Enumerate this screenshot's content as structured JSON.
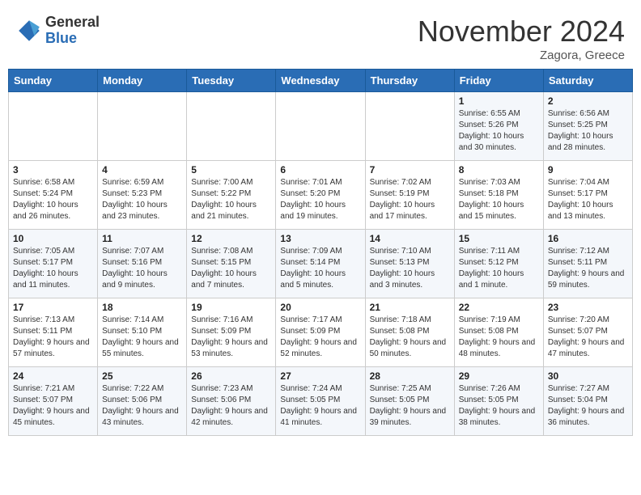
{
  "header": {
    "logo_general": "General",
    "logo_blue": "Blue",
    "month_title": "November 2024",
    "location": "Zagora, Greece"
  },
  "weekdays": [
    "Sunday",
    "Monday",
    "Tuesday",
    "Wednesday",
    "Thursday",
    "Friday",
    "Saturday"
  ],
  "weeks": [
    [
      {
        "day": "",
        "info": ""
      },
      {
        "day": "",
        "info": ""
      },
      {
        "day": "",
        "info": ""
      },
      {
        "day": "",
        "info": ""
      },
      {
        "day": "",
        "info": ""
      },
      {
        "day": "1",
        "info": "Sunrise: 6:55 AM\nSunset: 5:26 PM\nDaylight: 10 hours and 30 minutes."
      },
      {
        "day": "2",
        "info": "Sunrise: 6:56 AM\nSunset: 5:25 PM\nDaylight: 10 hours and 28 minutes."
      }
    ],
    [
      {
        "day": "3",
        "info": "Sunrise: 6:58 AM\nSunset: 5:24 PM\nDaylight: 10 hours and 26 minutes."
      },
      {
        "day": "4",
        "info": "Sunrise: 6:59 AM\nSunset: 5:23 PM\nDaylight: 10 hours and 23 minutes."
      },
      {
        "day": "5",
        "info": "Sunrise: 7:00 AM\nSunset: 5:22 PM\nDaylight: 10 hours and 21 minutes."
      },
      {
        "day": "6",
        "info": "Sunrise: 7:01 AM\nSunset: 5:20 PM\nDaylight: 10 hours and 19 minutes."
      },
      {
        "day": "7",
        "info": "Sunrise: 7:02 AM\nSunset: 5:19 PM\nDaylight: 10 hours and 17 minutes."
      },
      {
        "day": "8",
        "info": "Sunrise: 7:03 AM\nSunset: 5:18 PM\nDaylight: 10 hours and 15 minutes."
      },
      {
        "day": "9",
        "info": "Sunrise: 7:04 AM\nSunset: 5:17 PM\nDaylight: 10 hours and 13 minutes."
      }
    ],
    [
      {
        "day": "10",
        "info": "Sunrise: 7:05 AM\nSunset: 5:17 PM\nDaylight: 10 hours and 11 minutes."
      },
      {
        "day": "11",
        "info": "Sunrise: 7:07 AM\nSunset: 5:16 PM\nDaylight: 10 hours and 9 minutes."
      },
      {
        "day": "12",
        "info": "Sunrise: 7:08 AM\nSunset: 5:15 PM\nDaylight: 10 hours and 7 minutes."
      },
      {
        "day": "13",
        "info": "Sunrise: 7:09 AM\nSunset: 5:14 PM\nDaylight: 10 hours and 5 minutes."
      },
      {
        "day": "14",
        "info": "Sunrise: 7:10 AM\nSunset: 5:13 PM\nDaylight: 10 hours and 3 minutes."
      },
      {
        "day": "15",
        "info": "Sunrise: 7:11 AM\nSunset: 5:12 PM\nDaylight: 10 hours and 1 minute."
      },
      {
        "day": "16",
        "info": "Sunrise: 7:12 AM\nSunset: 5:11 PM\nDaylight: 9 hours and 59 minutes."
      }
    ],
    [
      {
        "day": "17",
        "info": "Sunrise: 7:13 AM\nSunset: 5:11 PM\nDaylight: 9 hours and 57 minutes."
      },
      {
        "day": "18",
        "info": "Sunrise: 7:14 AM\nSunset: 5:10 PM\nDaylight: 9 hours and 55 minutes."
      },
      {
        "day": "19",
        "info": "Sunrise: 7:16 AM\nSunset: 5:09 PM\nDaylight: 9 hours and 53 minutes."
      },
      {
        "day": "20",
        "info": "Sunrise: 7:17 AM\nSunset: 5:09 PM\nDaylight: 9 hours and 52 minutes."
      },
      {
        "day": "21",
        "info": "Sunrise: 7:18 AM\nSunset: 5:08 PM\nDaylight: 9 hours and 50 minutes."
      },
      {
        "day": "22",
        "info": "Sunrise: 7:19 AM\nSunset: 5:08 PM\nDaylight: 9 hours and 48 minutes."
      },
      {
        "day": "23",
        "info": "Sunrise: 7:20 AM\nSunset: 5:07 PM\nDaylight: 9 hours and 47 minutes."
      }
    ],
    [
      {
        "day": "24",
        "info": "Sunrise: 7:21 AM\nSunset: 5:07 PM\nDaylight: 9 hours and 45 minutes."
      },
      {
        "day": "25",
        "info": "Sunrise: 7:22 AM\nSunset: 5:06 PM\nDaylight: 9 hours and 43 minutes."
      },
      {
        "day": "26",
        "info": "Sunrise: 7:23 AM\nSunset: 5:06 PM\nDaylight: 9 hours and 42 minutes."
      },
      {
        "day": "27",
        "info": "Sunrise: 7:24 AM\nSunset: 5:05 PM\nDaylight: 9 hours and 41 minutes."
      },
      {
        "day": "28",
        "info": "Sunrise: 7:25 AM\nSunset: 5:05 PM\nDaylight: 9 hours and 39 minutes."
      },
      {
        "day": "29",
        "info": "Sunrise: 7:26 AM\nSunset: 5:05 PM\nDaylight: 9 hours and 38 minutes."
      },
      {
        "day": "30",
        "info": "Sunrise: 7:27 AM\nSunset: 5:04 PM\nDaylight: 9 hours and 36 minutes."
      }
    ]
  ]
}
